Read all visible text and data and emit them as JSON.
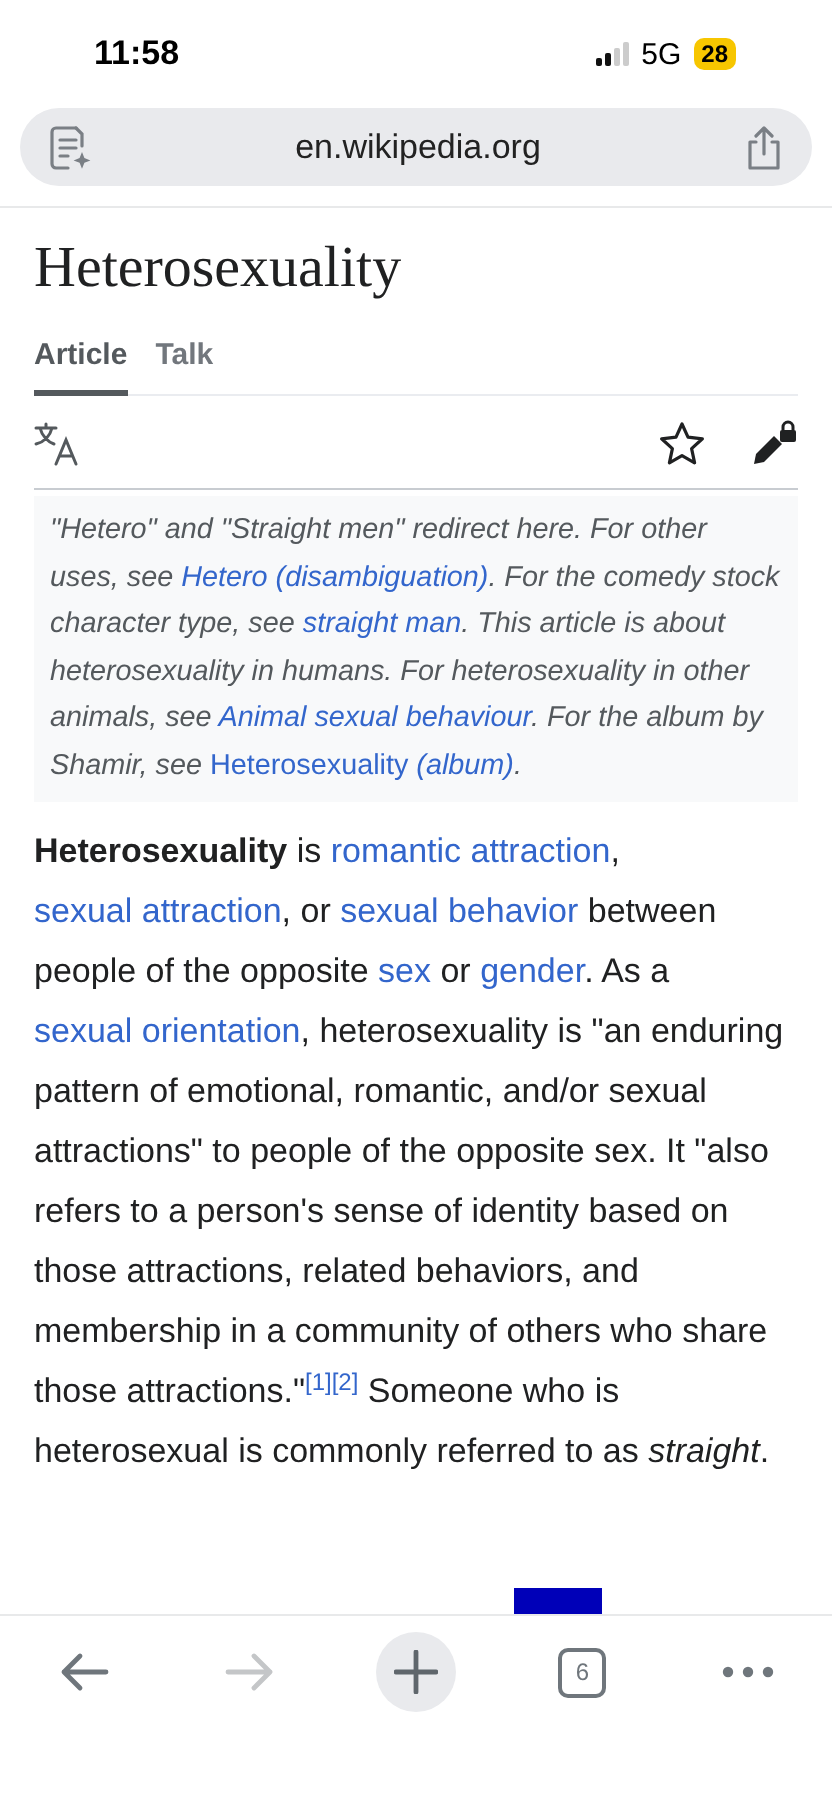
{
  "status_bar": {
    "time": "11:58",
    "network": "5G",
    "battery": "28"
  },
  "address_bar": {
    "url": "en.wikipedia.org"
  },
  "article": {
    "title": "Heterosexuality",
    "tabs": [
      {
        "label": "Article",
        "selected": true
      },
      {
        "label": "Talk",
        "selected": false
      }
    ],
    "hatnote": [
      {
        "kind": "text",
        "text": "\"Hetero\" and \"Straight men\" redirect here. For other uses, see "
      },
      {
        "kind": "link",
        "text": "Hetero (disambiguation)"
      },
      {
        "kind": "text",
        "text": ". For the comedy stock character type, see "
      },
      {
        "kind": "link",
        "text": "straight man"
      },
      {
        "kind": "text",
        "text": ". This article is about heterosexuality in humans. For heterosexuality in other animals, see "
      },
      {
        "kind": "link",
        "text": "Animal sexual behaviour"
      },
      {
        "kind": "text",
        "text": ". For the album by Shamir, see "
      },
      {
        "kind": "link",
        "text": "Heterosexuality *(album)*",
        "upright": true
      },
      {
        "kind": "text",
        "text": "."
      }
    ],
    "lead": [
      {
        "kind": "bold",
        "text": "Heterosexuality"
      },
      {
        "kind": "text",
        "text": " is "
      },
      {
        "kind": "link",
        "text": "romantic attraction"
      },
      {
        "kind": "text",
        "text": ", "
      },
      {
        "kind": "link",
        "text": "sexual attraction"
      },
      {
        "kind": "text",
        "text": ", or "
      },
      {
        "kind": "link",
        "text": "sexual behavior"
      },
      {
        "kind": "text",
        "text": " between people of the opposite "
      },
      {
        "kind": "link",
        "text": "sex"
      },
      {
        "kind": "text",
        "text": " or "
      },
      {
        "kind": "link",
        "text": "gender"
      },
      {
        "kind": "text",
        "text": ". As a "
      },
      {
        "kind": "link",
        "text": "sexual orientation"
      },
      {
        "kind": "text",
        "text": ", heterosexuality is \"an enduring pattern of emotional, romantic, and/or sexual attractions\" to people of the opposite sex. It \"also refers to a person's sense of identity based on those attractions, related behaviors, and membership in a community of others who share those attractions.\""
      },
      {
        "kind": "ref",
        "text": "[1]"
      },
      {
        "kind": "ref",
        "text": "[2]"
      },
      {
        "kind": "text",
        "text": " Someone who is heterosexual is commonly referred to as "
      },
      {
        "kind": "italic",
        "text": "straight"
      },
      {
        "kind": "text",
        "text": "."
      }
    ]
  },
  "toolbar": {
    "items": [
      {
        "kind": "back",
        "disabled": false
      },
      {
        "kind": "forward",
        "disabled": true
      },
      {
        "kind": "new-tab",
        "disabled": false
      },
      {
        "kind": "tabs",
        "count": "6",
        "disabled": false
      },
      {
        "kind": "more",
        "disabled": false
      }
    ]
  }
}
